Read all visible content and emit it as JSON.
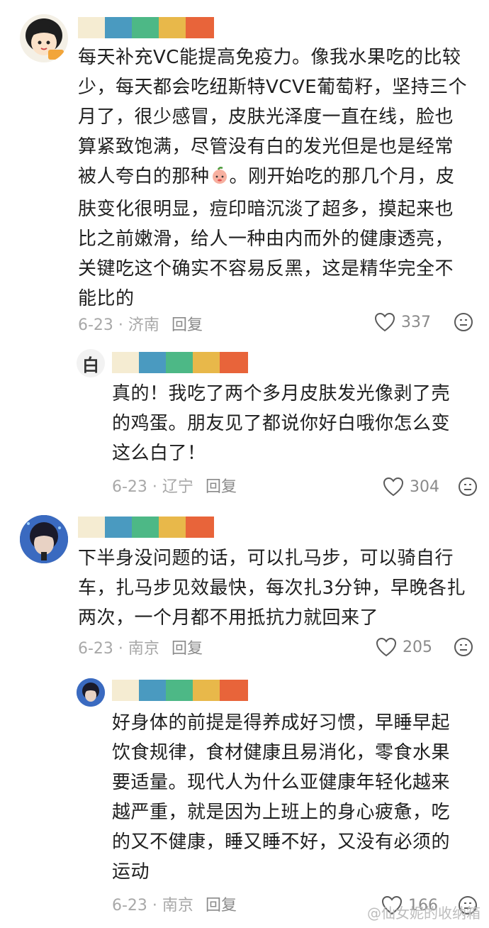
{
  "bar_colors": [
    "#f5ecd2",
    "#4a9ac0",
    "#4db886",
    "#e8b84a",
    "#e8643a"
  ],
  "comments": [
    {
      "lines": [
        "每天补充VC能提高免疫力。像我水果吃的比较",
        "少，每天都会吃纽斯特VCVE葡萄籽，坚持三个",
        "月了，很少感冒，皮肤光泽度一直在线，脸也",
        "算紧致饱满，尽管没有白的发光但是也是经常",
        "被人夸白的那种",
        "。刚开始吃的那几个月，皮",
        "肤变化很明显，痘印暗沉淡了超多，摸起来也",
        "比之前嫩滑，给人一种由内而外的健康透亮，",
        "关键吃这个确实不容易反黑，这是精华完全不",
        "能比的"
      ],
      "date": "6-23",
      "location": "济南",
      "reply": "回复",
      "likes": "337"
    },
    {
      "lines": [
        "真的！我吃了两个多月皮肤发光像剥了壳",
        "的鸡蛋。朋友见了都说你好白哦你怎么变",
        "这么白了！"
      ],
      "date": "6-23",
      "location": "辽宁",
      "reply": "回复",
      "likes": "304"
    },
    {
      "lines": [
        "下半身没问题的话，可以扎马步，可以骑自行",
        "车，扎马步见效最快，每次扎3分钟，早晚各扎",
        "两次，一个月都不用抵抗力就回来了"
      ],
      "date": "6-23",
      "location": "南京",
      "reply": "回复",
      "likes": "205"
    },
    {
      "lines": [
        "好身体的前提是得养成好习惯，早睡早起",
        "饮食规律，食材健康且易消化，零食水果",
        "要适量。现代人为什么亚健康年轻化越来",
        "越严重，就是因为上班上的身心疲惫，吃",
        "的又不健康，睡又睡不好，又没有必须的",
        "运动"
      ],
      "date": "6-23",
      "location": "南京",
      "reply": "回复",
      "likes": "166"
    }
  ],
  "avatar2_char": "白",
  "watermark": "@仙女妮的收纳箱"
}
